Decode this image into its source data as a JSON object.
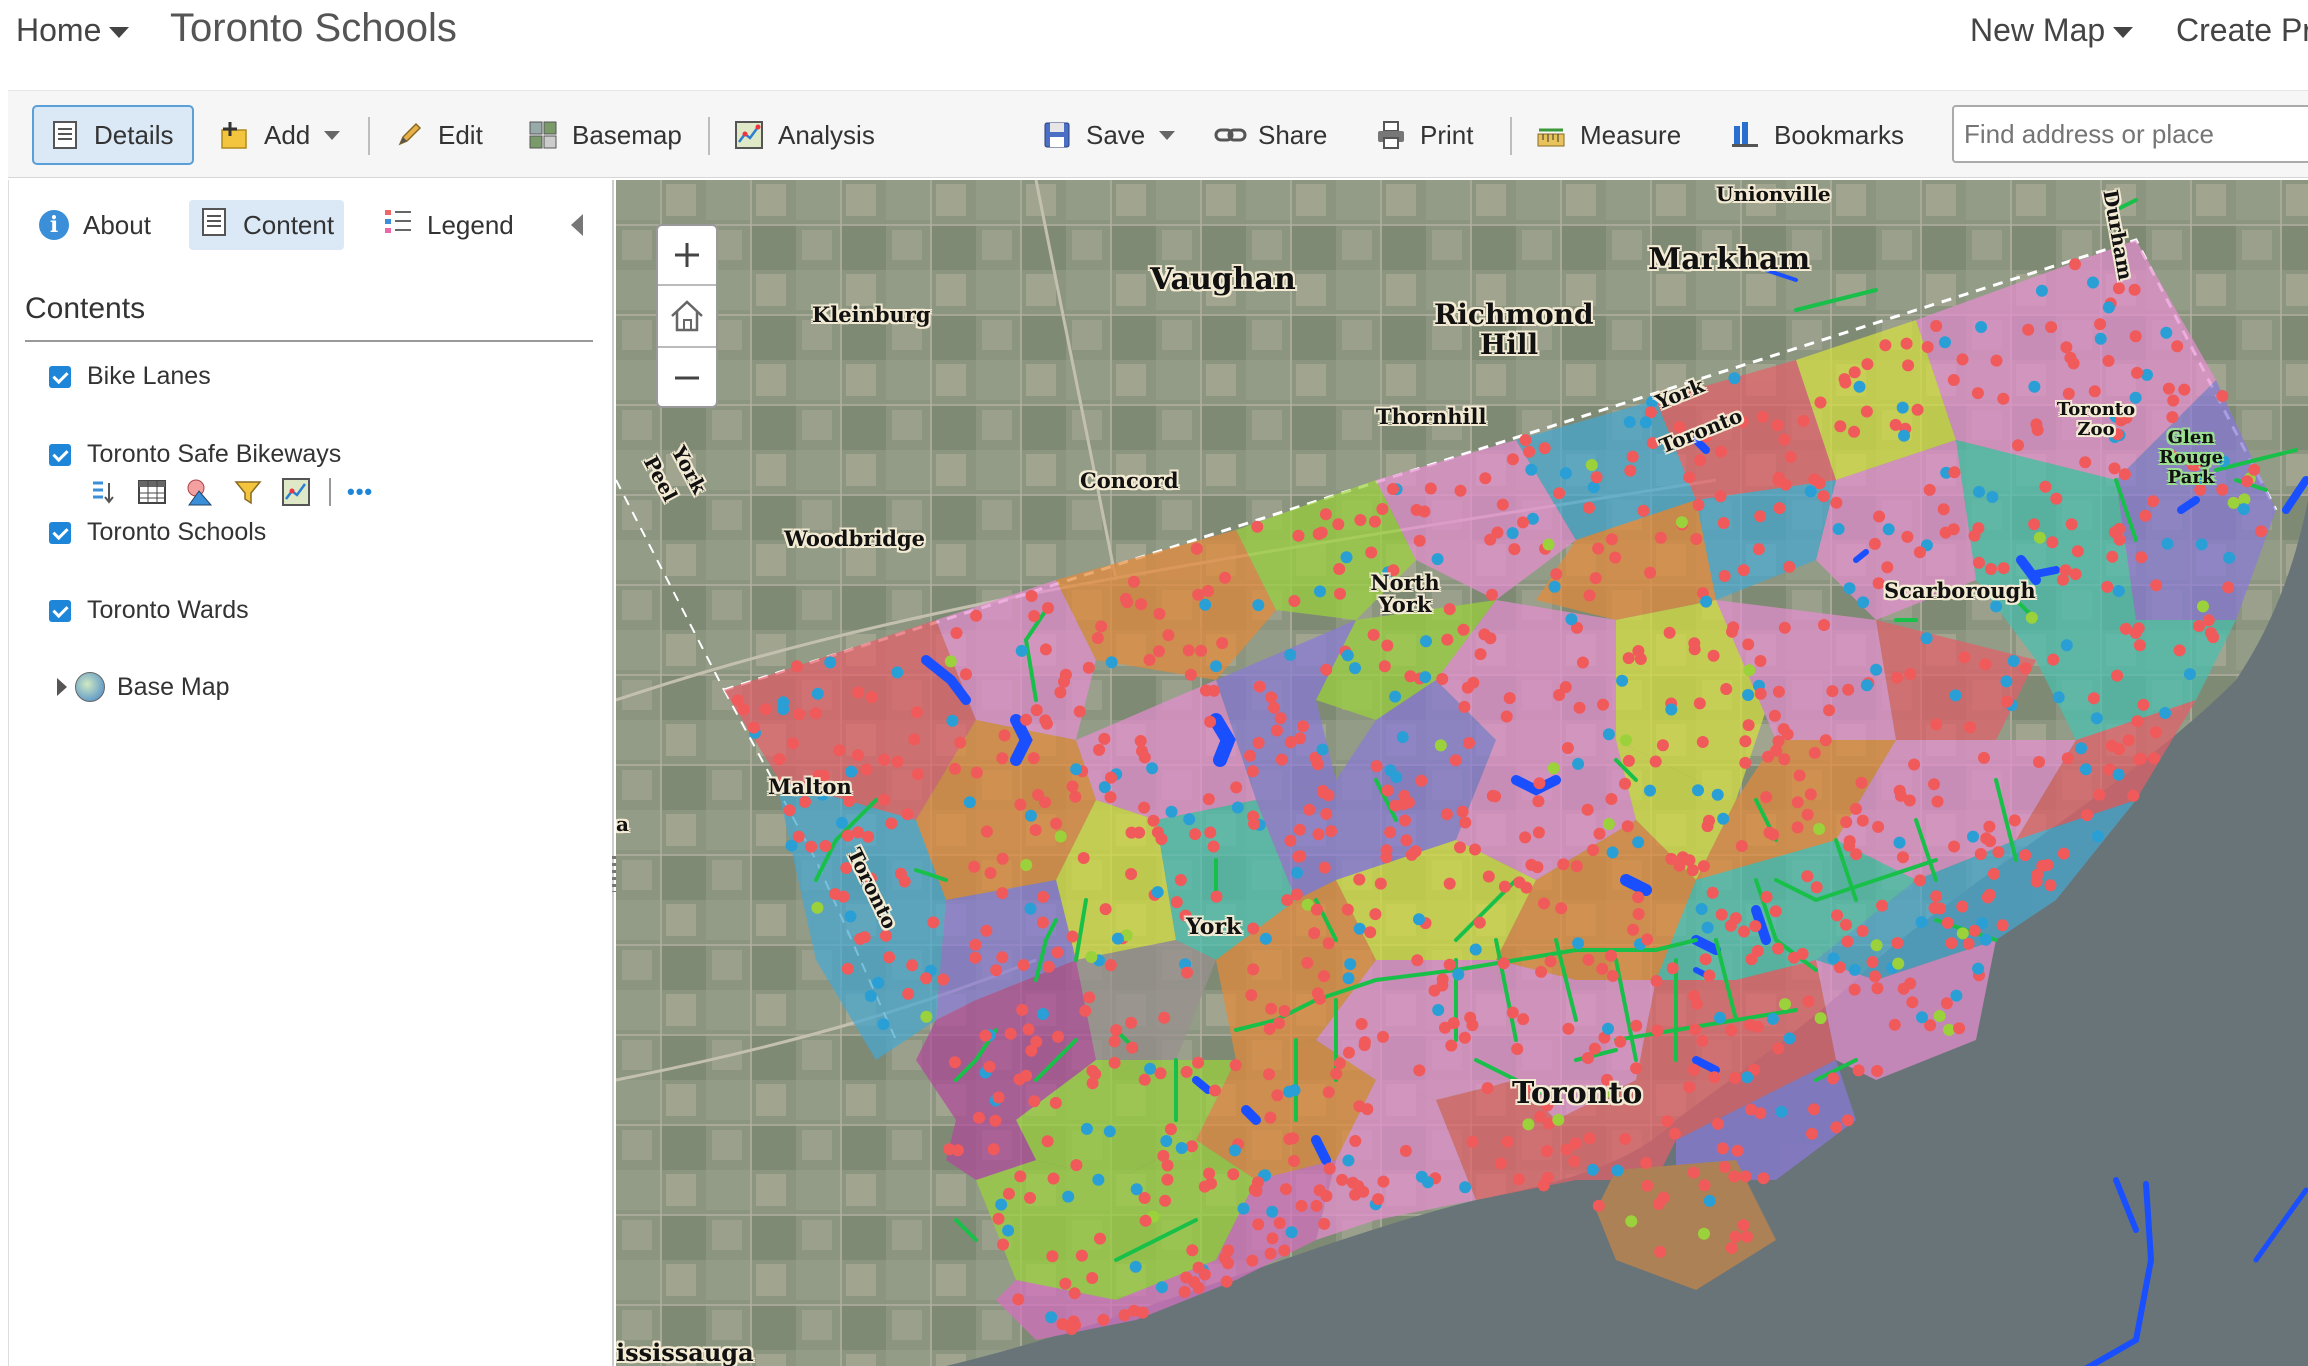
{
  "header": {
    "home_label": "Home",
    "title": "Toronto Schools",
    "new_map_label": "New Map",
    "create_label": "Create Pr"
  },
  "toolbar": {
    "details_label": "Details",
    "add_label": "Add",
    "edit_label": "Edit",
    "basemap_label": "Basemap",
    "analysis_label": "Analysis",
    "save_label": "Save",
    "share_label": "Share",
    "print_label": "Print",
    "measure_label": "Measure",
    "bookmarks_label": "Bookmarks",
    "search_placeholder": "Find address or place"
  },
  "side_panel": {
    "tabs": [
      {
        "label": "About"
      },
      {
        "label": "Content"
      },
      {
        "label": "Legend"
      }
    ],
    "contents_title": "Contents",
    "layers": [
      {
        "label": "Bike Lanes",
        "checked": true
      },
      {
        "label": "Toronto Safe Bikeways",
        "checked": true
      },
      {
        "label": "Toronto Schools",
        "checked": true
      },
      {
        "label": "Toronto Wards",
        "checked": true
      },
      {
        "label": "Base Map"
      }
    ],
    "more_label": "•••"
  },
  "map": {
    "place_labels": {
      "unionville": "Unionville",
      "durham": "Durham",
      "vaughan": "Vaughan",
      "markham": "Markham",
      "kleinburg": "Kleinburg",
      "richmond_hill": "Richmond Hill",
      "thornhill": "Thornhill",
      "york_region": "York",
      "toronto_boundary": "Toronto",
      "toronto_zoo": "Toronto Zoo",
      "glen_rouge_park": "Glen Rouge Park",
      "peel": "Peel",
      "york_boundary": "York",
      "concord": "Concord",
      "woodbridge": "Woodbridge",
      "north_york": "North York",
      "scarborough": "Scarborough",
      "malton": "Malton",
      "toronto_west": "Toronto",
      "york": "York",
      "toronto": "Toronto",
      "mississauga": "ississauga",
      "edge_a": "a"
    },
    "colors": {
      "water": "#6b7578",
      "school_primary": "#f05a5a",
      "school_secondary": "#2a9fd6",
      "school_other": "#9bd23c",
      "bike_lane": "#18c04a",
      "safe_bikeway": "#1a4fff"
    }
  }
}
